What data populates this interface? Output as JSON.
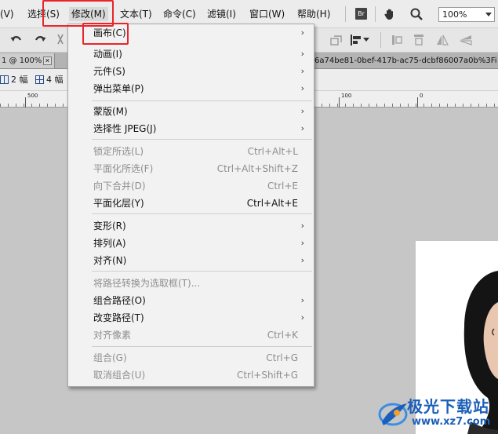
{
  "menubar": {
    "items": [
      {
        "label": "(V)"
      },
      {
        "label": "选择(S)"
      },
      {
        "label": "修改(M)"
      },
      {
        "label": "文本(T)"
      },
      {
        "label": "命令(C)"
      },
      {
        "label": "滤镜(I)"
      },
      {
        "label": "窗口(W)"
      },
      {
        "label": "帮助(H)"
      }
    ],
    "bridge_icon_text": "Br",
    "zoom_value": "100%"
  },
  "tabbar": {
    "doc_tab_label": "1 @ 100%",
    "close_glyph": "✕",
    "filename": "6a74be81-0bef-417b-ac75-dcbf86007a0b%3Fi"
  },
  "viewbar": {
    "two_up_label": "2 幅",
    "four_up_label": "4 幅"
  },
  "ruler": {
    "labels": [
      "500",
      "100",
      "0"
    ]
  },
  "dropdown": {
    "items": [
      {
        "label": "画布(C)",
        "shortcut": "",
        "submenu": true,
        "disabled": false
      },
      {
        "label": "动画(I)",
        "shortcut": "",
        "submenu": true,
        "disabled": false
      },
      {
        "label": "元件(S)",
        "shortcut": "",
        "submenu": true,
        "disabled": false
      },
      {
        "label": "弹出菜单(P)",
        "shortcut": "",
        "submenu": true,
        "disabled": false
      },
      {
        "label": "蒙版(M)",
        "shortcut": "",
        "submenu": true,
        "disabled": false
      },
      {
        "label": "选择性 JPEG(J)",
        "shortcut": "",
        "submenu": true,
        "disabled": false
      },
      {
        "label": "锁定所选(L)",
        "shortcut": "Ctrl+Alt+L",
        "submenu": false,
        "disabled": true
      },
      {
        "label": "平面化所选(F)",
        "shortcut": "Ctrl+Alt+Shift+Z",
        "submenu": false,
        "disabled": true
      },
      {
        "label": "向下合并(D)",
        "shortcut": "Ctrl+E",
        "submenu": false,
        "disabled": true
      },
      {
        "label": "平面化层(Y)",
        "shortcut": "Ctrl+Alt+E",
        "submenu": false,
        "disabled": false
      },
      {
        "label": "变形(R)",
        "shortcut": "",
        "submenu": true,
        "disabled": false
      },
      {
        "label": "排列(A)",
        "shortcut": "",
        "submenu": true,
        "disabled": false
      },
      {
        "label": "对齐(N)",
        "shortcut": "",
        "submenu": true,
        "disabled": false
      },
      {
        "label": "将路径转换为选取框(T)...",
        "shortcut": "",
        "submenu": false,
        "disabled": true
      },
      {
        "label": "组合路径(O)",
        "shortcut": "",
        "submenu": true,
        "disabled": false
      },
      {
        "label": "改变路径(T)",
        "shortcut": "",
        "submenu": true,
        "disabled": false
      },
      {
        "label": "对齐像素",
        "shortcut": "Ctrl+K",
        "submenu": false,
        "disabled": true
      },
      {
        "label": "组合(G)",
        "shortcut": "Ctrl+G",
        "submenu": false,
        "disabled": true
      },
      {
        "label": "取消组合(U)",
        "shortcut": "Ctrl+Shift+G",
        "submenu": false,
        "disabled": true
      }
    ],
    "submenu_arrow": "›"
  },
  "watermark": {
    "brand": "极光下载站",
    "url": "www.xz7.com"
  },
  "colors": {
    "highlight": "#e8262a",
    "watermark": "#1c5fb8"
  }
}
